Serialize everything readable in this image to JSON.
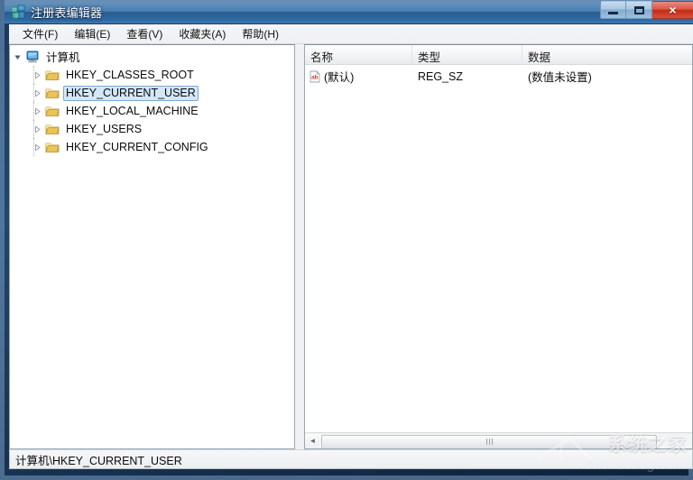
{
  "window": {
    "title": "注册表编辑器",
    "icon": "regedit-icon",
    "controls": {
      "minimize_label": "最小化",
      "maximize_label": "最大化",
      "close_label": "×"
    }
  },
  "menubar": {
    "items": [
      {
        "label": "文件(F)",
        "name": "menu-file"
      },
      {
        "label": "编辑(E)",
        "name": "menu-edit"
      },
      {
        "label": "查看(V)",
        "name": "menu-view"
      },
      {
        "label": "收藏夹(A)",
        "name": "menu-favorites"
      },
      {
        "label": "帮助(H)",
        "name": "menu-help"
      }
    ]
  },
  "tree": {
    "root": {
      "label": "计算机",
      "expanded": true,
      "icon": "computer-icon"
    },
    "items": [
      {
        "label": "HKEY_CLASSES_ROOT",
        "icon": "folder-icon",
        "selected": false
      },
      {
        "label": "HKEY_CURRENT_USER",
        "icon": "folder-icon",
        "selected": true
      },
      {
        "label": "HKEY_LOCAL_MACHINE",
        "icon": "folder-icon",
        "selected": false
      },
      {
        "label": "HKEY_USERS",
        "icon": "folder-icon",
        "selected": false
      },
      {
        "label": "HKEY_CURRENT_CONFIG",
        "icon": "folder-icon",
        "selected": false
      }
    ]
  },
  "list": {
    "columns": [
      {
        "label": "名称"
      },
      {
        "label": "类型"
      },
      {
        "label": "数据"
      }
    ],
    "rows": [
      {
        "icon": "string-value-icon",
        "name": "(默认)",
        "type": "REG_SZ",
        "data": "(数值未设置)"
      }
    ]
  },
  "scrollbar": {
    "left_arrow": "◄"
  },
  "statusbar": {
    "path": "计算机\\HKEY_CURRENT_USER"
  },
  "watermark": {
    "brand": "系统之家",
    "url": "www.ucbug.com"
  },
  "colors": {
    "titlebar_blue": "#3f79ae",
    "close_red": "#c32c15",
    "selection_blue": "#d4e7f8",
    "selection_border": "#7ca8d2",
    "folder_yellow": "#e8c45a"
  }
}
